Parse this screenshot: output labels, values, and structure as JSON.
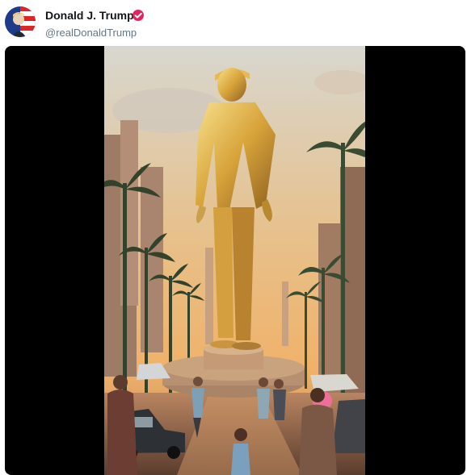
{
  "post": {
    "author_name": "Donald J. Trump",
    "handle": "@realDonaldTrump",
    "verified": true,
    "avatar_icon": "flag-portrait-avatar",
    "badge_color": "#e0245e"
  },
  "media": {
    "type": "video",
    "playing": true
  }
}
